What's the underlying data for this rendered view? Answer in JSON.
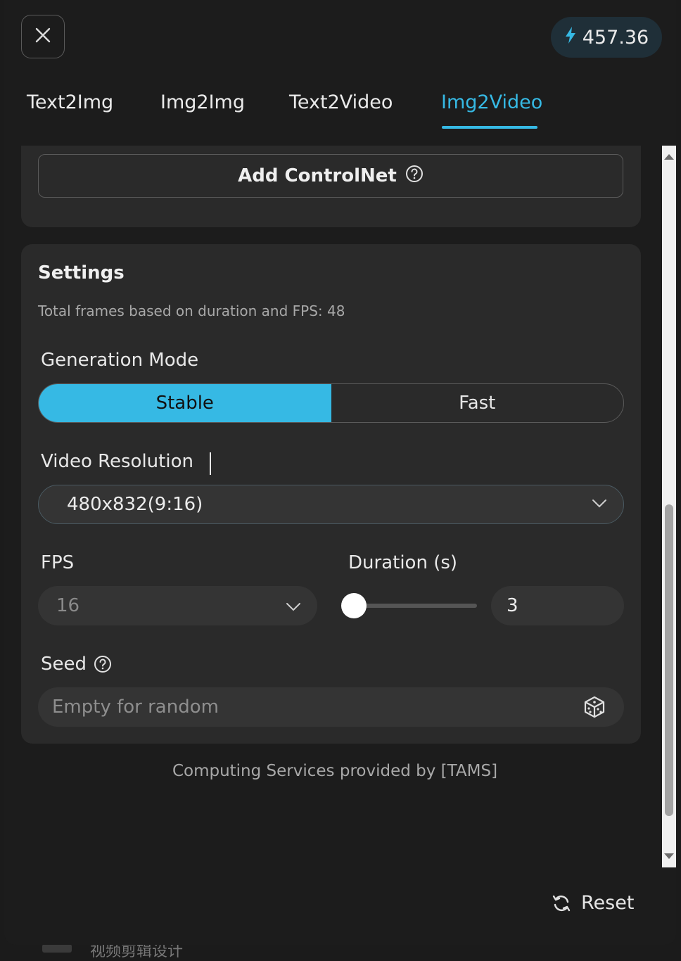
{
  "header": {
    "credits": "457.36",
    "credits_color": "#36b9e4"
  },
  "tabs": [
    {
      "label": "Text2Img",
      "active": false
    },
    {
      "label": "Img2Img",
      "active": false
    },
    {
      "label": "Text2Video",
      "active": false
    },
    {
      "label": "Img2Video",
      "active": true
    }
  ],
  "controlnet": {
    "button_label": "Add ControlNet"
  },
  "settings": {
    "title": "Settings",
    "subtitle": "Total frames based on duration and FPS: 48",
    "generation_mode": {
      "label": "Generation Mode",
      "options": [
        "Stable",
        "Fast"
      ],
      "selected": "Stable"
    },
    "video_resolution": {
      "label": "Video Resolution",
      "value": "480x832(9:16)"
    },
    "fps": {
      "label": "FPS",
      "value": "16"
    },
    "duration": {
      "label": "Duration (s)",
      "value": "3",
      "slider_fraction": 0.0
    },
    "seed": {
      "label": "Seed",
      "placeholder": "Empty for random"
    }
  },
  "footer": {
    "note": "Computing Services provided by [TAMS]",
    "reset_label": "Reset"
  },
  "colors": {
    "accent": "#36b9e4",
    "panel": "#2a2a2a",
    "background": "#1c1c1c"
  },
  "background_text": "视频剪辑设计"
}
